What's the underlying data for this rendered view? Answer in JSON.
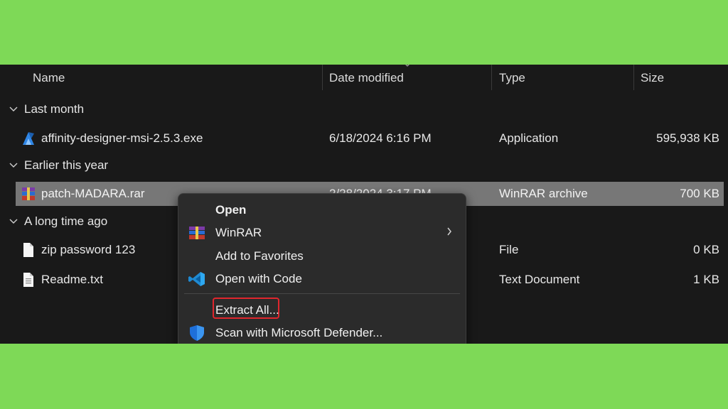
{
  "columns": {
    "name": "Name",
    "date": "Date modified",
    "type": "Type",
    "size": "Size"
  },
  "groups": [
    {
      "label": "Last month"
    },
    {
      "label": "Earlier this year"
    },
    {
      "label": "A long time ago"
    }
  ],
  "files": [
    {
      "name": "affinity-designer-msi-2.5.3.exe",
      "date": "6/18/2024 6:16 PM",
      "type": "Application",
      "size": "595,938 KB",
      "icon": "affinity-designer-icon"
    },
    {
      "name": "patch-MADARA.rar",
      "date": "2/28/2024 3:17 PM",
      "type": "WinRAR archive",
      "size": "700 KB",
      "icon": "winrar-icon",
      "selected": true
    },
    {
      "name": "zip password 123",
      "date": "",
      "type": "File",
      "size": "0 KB",
      "icon": "blank-file-icon"
    },
    {
      "name": "Readme.txt",
      "date": "",
      "type": "Text Document",
      "size": "1 KB",
      "icon": "text-file-icon"
    }
  ],
  "context_menu": {
    "items": [
      {
        "label": "Open",
        "bold": true,
        "icon": ""
      },
      {
        "label": "WinRAR",
        "icon": "winrar-icon",
        "submenu": true
      },
      {
        "label": "Add to Favorites",
        "icon": ""
      },
      {
        "label": "Open with Code",
        "icon": "vscode-icon"
      },
      {
        "label": "Extract All...",
        "icon": "",
        "highlighted": true
      },
      {
        "label": "Scan with Microsoft Defender...",
        "icon": "defender-shield-icon"
      }
    ]
  },
  "colors": {
    "background": "#7ed957",
    "panel": "#191919",
    "selected_row": "#777777",
    "menu": "#2b2b2b",
    "highlight_border": "#e0262d"
  }
}
